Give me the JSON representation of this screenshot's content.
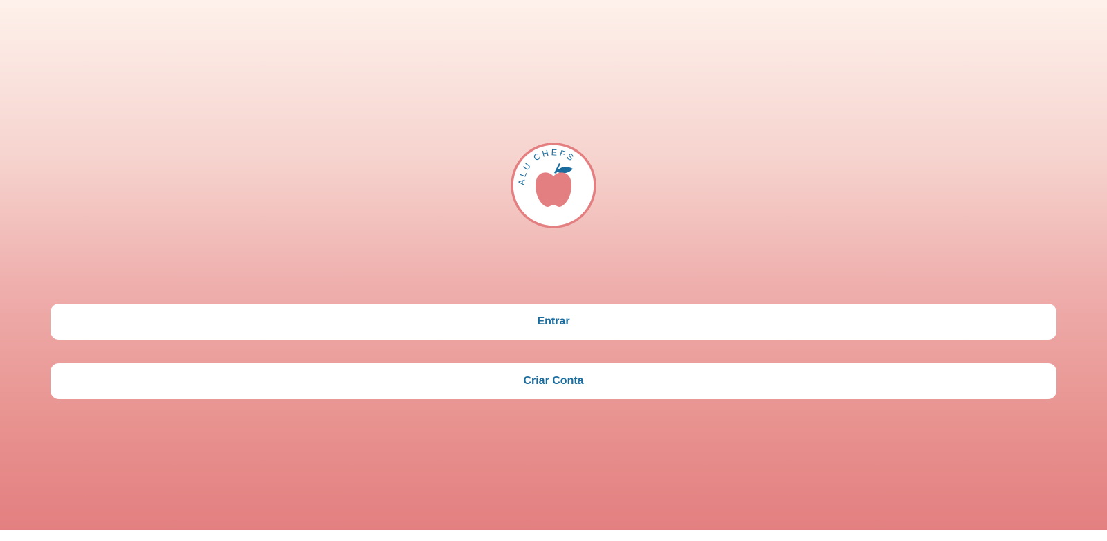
{
  "logo": {
    "brand_text": "ALU CHEFS",
    "icon": "apple-icon",
    "ring_color": "#e37f80",
    "text_color": "#1a6c9e"
  },
  "actions": {
    "login_label": "Entrar",
    "signup_label": "Criar Conta"
  },
  "colors": {
    "accent": "#1a6c9e",
    "gradient_top": "#fef1eb",
    "gradient_bottom": "#e37f80"
  }
}
